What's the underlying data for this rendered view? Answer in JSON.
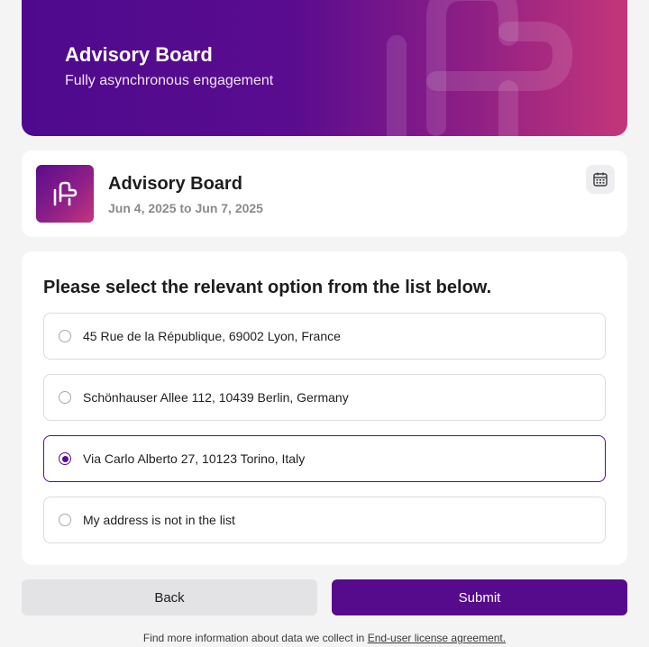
{
  "hero": {
    "title": "Advisory Board",
    "subtitle": "Fully asynchronous engagement",
    "logo_icon": "brand-logo-icon"
  },
  "event": {
    "title": "Advisory Board",
    "dates": "Jun 4, 2025 to Jun 7, 2025",
    "logo_icon": "brand-logo-icon",
    "calendar_icon": "calendar-icon"
  },
  "form": {
    "question": "Please select the relevant option from the list below.",
    "options": [
      {
        "label": "45 Rue de la République, 69002 Lyon, France",
        "selected": false
      },
      {
        "label": "Schönhauser Allee 112, 10439 Berlin, Germany",
        "selected": false
      },
      {
        "label": "Via Carlo Alberto 27, 10123 Torino, Italy",
        "selected": true
      },
      {
        "label": "My address is not in the list",
        "selected": false
      }
    ]
  },
  "actions": {
    "back_label": "Back",
    "submit_label": "Submit"
  },
  "footer": {
    "text": "Find more information about data we collect in",
    "link_label": "End-user license agreement."
  },
  "colors": {
    "accent": "#560a8c",
    "gradient_start": "#4e0a8e",
    "gradient_end": "#c4367a"
  }
}
